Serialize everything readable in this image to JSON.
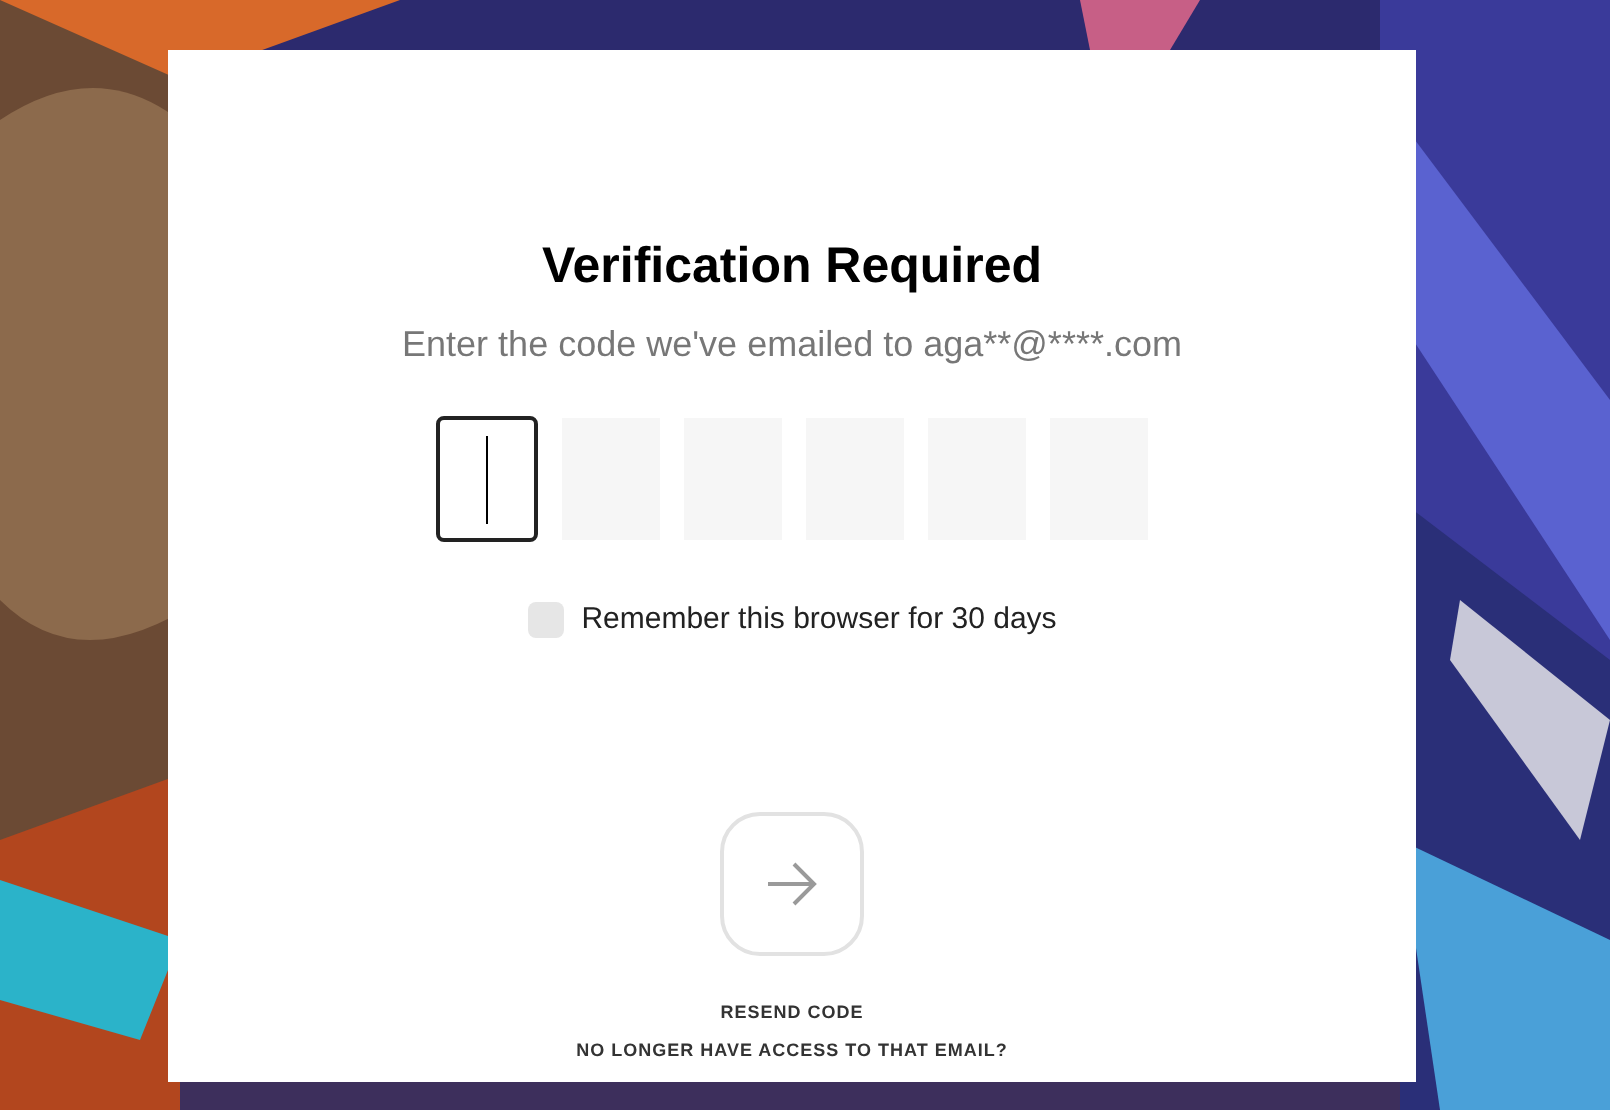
{
  "dialog": {
    "title": "Verification Required",
    "subtitle": "Enter the code we've emailed to aga**@****.com",
    "code_boxes": [
      {
        "selected": true
      },
      {
        "selected": false
      },
      {
        "selected": false
      },
      {
        "selected": false
      },
      {
        "selected": false
      },
      {
        "selected": false
      }
    ],
    "remember": {
      "label": "Remember this browser for 30 days",
      "checked": false
    },
    "submit": {
      "disabled": true
    },
    "links": [
      "RESEND CODE",
      "NO LONGER HAVE ACCESS TO THAT EMAIL?"
    ]
  }
}
